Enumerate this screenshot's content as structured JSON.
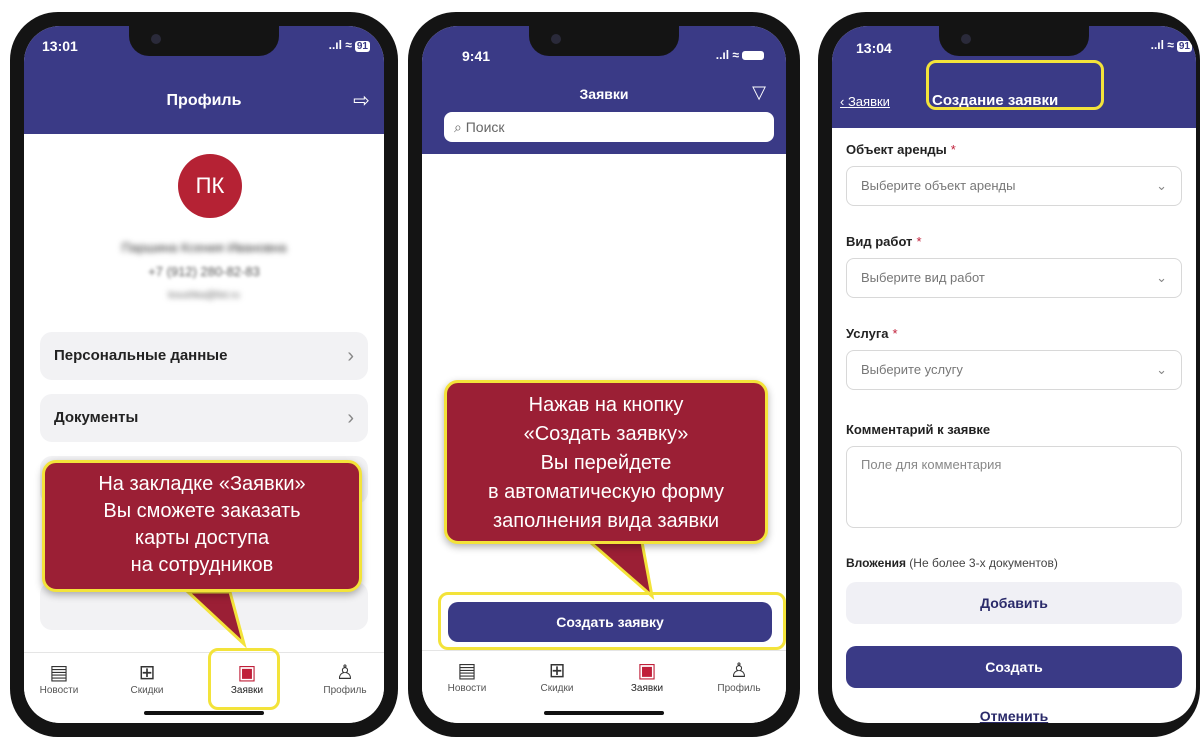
{
  "phone1": {
    "status_time": "13:01",
    "status_icons": "..ıl ≈",
    "battery": "91",
    "title": "Профиль",
    "avatar_initials": "ПК",
    "user_name": "Паршина Ксения Ивановна",
    "phone": "+7 (912) 280-82-83",
    "email": "koushka@list.ru",
    "menu_items": [
      "Персональные данные",
      "Документы"
    ],
    "callout": [
      "На закладке «Заявки»",
      "Вы сможете заказать",
      "карты доступа",
      "на сотрудников"
    ],
    "tabs": [
      "Новости",
      "Скидки",
      "Заявки",
      "Профиль"
    ]
  },
  "phone2": {
    "status_time": "9:41",
    "status_icons": "..ıl ≈",
    "title": "Заявки",
    "search_placeholder": "Поиск",
    "callout": [
      "Нажав на кнопку",
      "«Создать заявку»",
      "Вы перейдете",
      "в автоматическую форму",
      "заполнения вида заявки"
    ],
    "create_button": "Создать заявку",
    "tabs": [
      "Новости",
      "Скидки",
      "Заявки",
      "Профиль"
    ]
  },
  "phone3": {
    "status_time": "13:04",
    "status_icons": "..ıl ≈",
    "battery": "91",
    "back_label": "Заявки",
    "title": "Создание заявки",
    "fields": [
      {
        "label": "Объект аренды",
        "placeholder": "Выберите объект аренды"
      },
      {
        "label": "Вид работ",
        "placeholder": "Выберите вид работ"
      },
      {
        "label": "Услуга",
        "placeholder": "Выберите услугу"
      }
    ],
    "required_mark": "*",
    "comment_label": "Комментарий к заявке",
    "comment_placeholder": "Поле для комментария",
    "attachments_label": "Вложения",
    "attachments_hint": "(Не более 3-х документов)",
    "add_button": "Добавить",
    "create_button": "Создать",
    "cancel_link": "Отменить"
  },
  "colors": {
    "header": "#3a3a86",
    "accent_red": "#c0203a",
    "callout": "#9b1f35",
    "highlight": "#f3e33a"
  }
}
